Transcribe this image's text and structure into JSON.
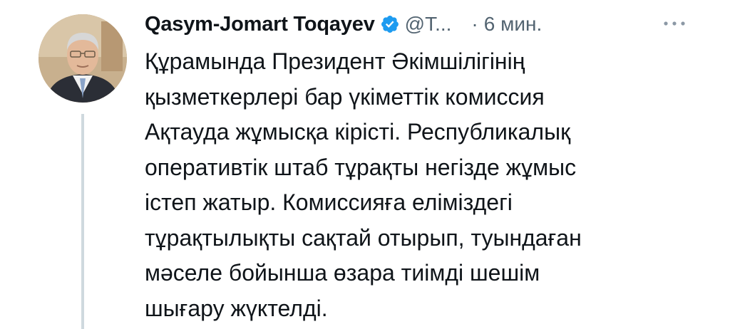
{
  "tweet": {
    "author": {
      "display_name": "Qasym-Jomart Toqayev",
      "handle": "@T...",
      "verified": true,
      "avatar_icon": "profile-photo"
    },
    "separator": "·",
    "time": "6 мин.",
    "more_icon": "ellipsis-icon",
    "text_lines": [
      "Құрамында Президент Әкімшілігінің",
      "қызметкерлері бар үкіметтік комиссия",
      "Ақтауда жұмысқа кірісті. Республикалық",
      "оперативтік штаб тұрақты негізде жұмыс",
      "істеп жатыр. Комиссияға еліміздегі",
      "тұрақтылықты сақтай отырып, туындаған",
      "мәселе бойынша өзара тиімді шешім",
      "шығару жүктелді."
    ]
  },
  "colors": {
    "text_primary": "#0f1419",
    "text_secondary": "#536471",
    "verified_blue": "#1d9bf0",
    "thread_line": "#cfd9de"
  }
}
